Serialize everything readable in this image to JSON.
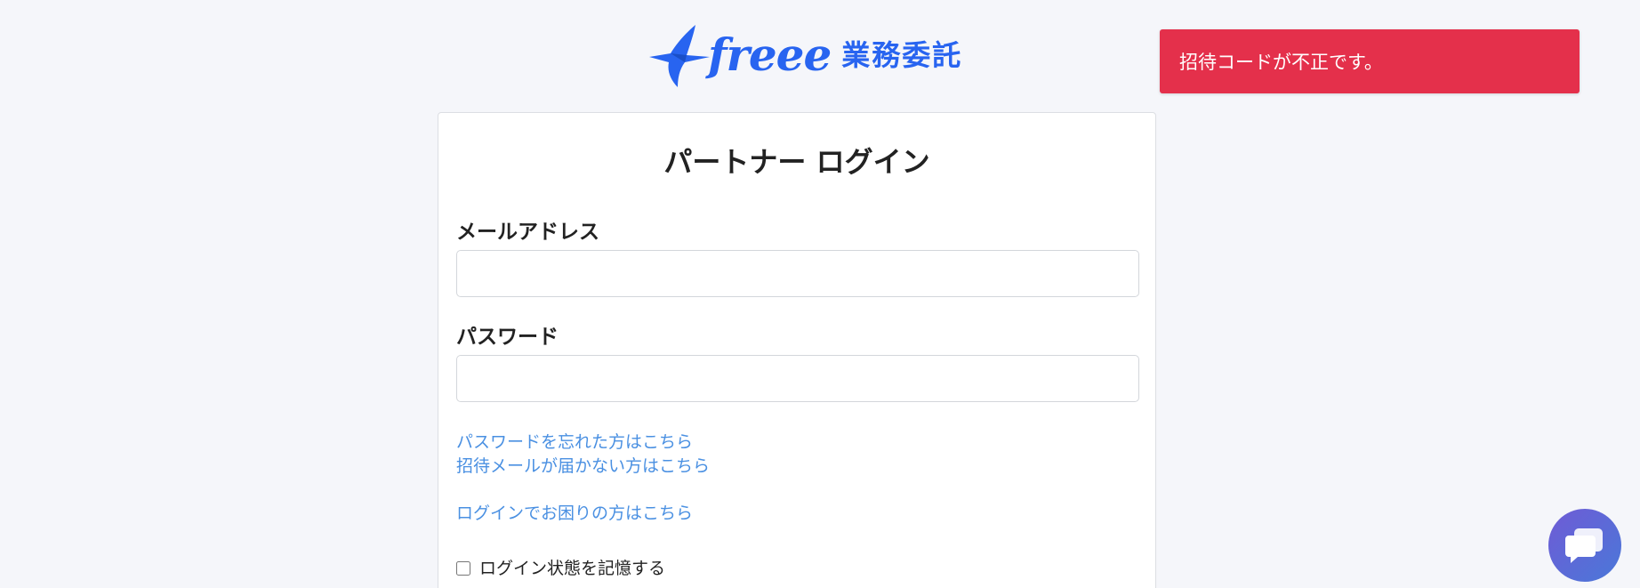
{
  "header": {
    "logo_word": "freee",
    "logo_product": "業務委託"
  },
  "toast": {
    "message": "招待コードが不正です。",
    "color": "#e4304b"
  },
  "login": {
    "title": "パートナー ログイン",
    "email_label": "メールアドレス",
    "email_value": "",
    "password_label": "パスワード",
    "password_value": "",
    "forgot_password_link": "パスワードを忘れた方はこちら",
    "invite_not_received_link": "招待メールが届かない方はこちら",
    "login_help_link": "ログインでお困りの方はこちら",
    "remember_label": "ログイン状態を記憶する",
    "remember_checked": false
  },
  "colors": {
    "brand": "#2864f0",
    "link": "#4a90e2",
    "background": "#f5f6fa"
  },
  "chat": {
    "icon": "chat-bubble-icon"
  }
}
